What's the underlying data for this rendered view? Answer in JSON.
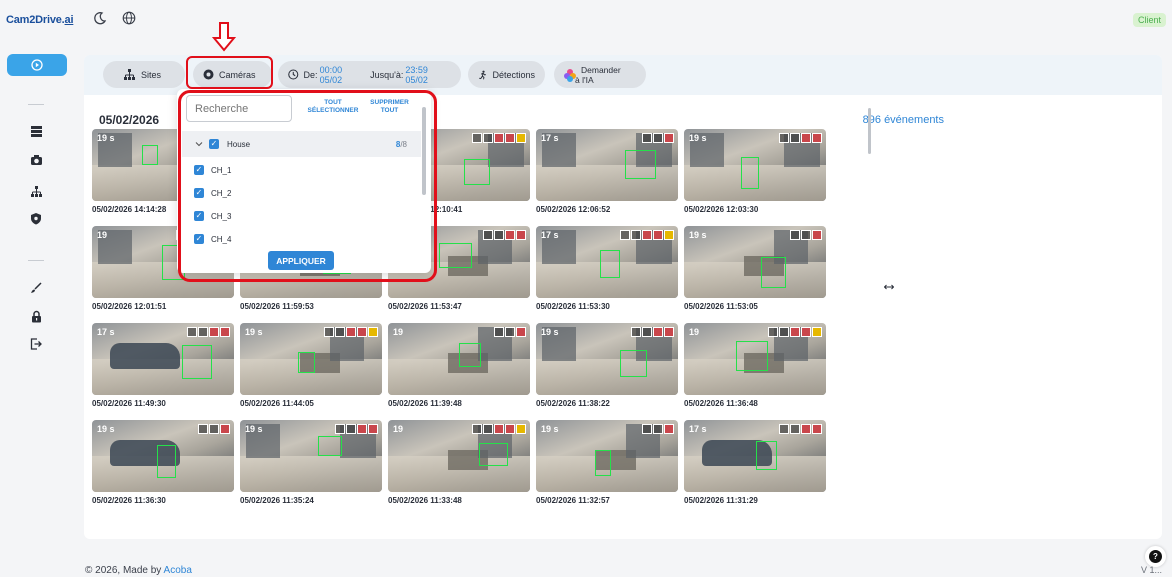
{
  "app": {
    "logo_text": "Cam2Drive.",
    "logo_ai": "ai",
    "client_badge": "Client"
  },
  "sidebar": {
    "items": [
      {
        "name": "events",
        "icon": "play-circle-icon",
        "active": true
      },
      {
        "name": "recorders",
        "icon": "server-icon"
      },
      {
        "name": "cameras",
        "icon": "camera-icon"
      },
      {
        "name": "sites",
        "icon": "sitemap-icon"
      },
      {
        "name": "security",
        "icon": "shield-icon"
      },
      {
        "name": "edit",
        "icon": "brush-icon"
      },
      {
        "name": "lock",
        "icon": "lock-icon"
      },
      {
        "name": "logout",
        "icon": "logout-icon"
      }
    ]
  },
  "filters": {
    "sites_label": "Sites",
    "cameras_label": "Caméras",
    "from_label": "De:",
    "from_value": "00:00 05/02",
    "to_label": "Jusqu'à:",
    "to_value": "23:59 05/02",
    "detections_label": "Détections",
    "ask_ai_line1": "Demander",
    "ask_ai_line2": "à l'IA"
  },
  "dropdown": {
    "search_placeholder": "Recherche",
    "select_all_line1": "TOUT",
    "select_all_line2": "SÉLECTIONNER",
    "remove_all_line1": "SUPPRIMER",
    "remove_all_line2": "TOUT",
    "group_name": "House",
    "group_count": "8",
    "group_total": "/8",
    "channels": [
      "CH_1",
      "CH_2",
      "CH_3",
      "CH_4"
    ],
    "apply_label": "APPLIQUER"
  },
  "events": {
    "date": "05/02/2026",
    "count_label": "896 événements",
    "tiles": [
      {
        "duration": "19 s",
        "timestamp": "05/02/2026 14:14:28",
        "scene": "shop"
      },
      {
        "duration": "",
        "timestamp": "",
        "scene": "shop"
      },
      {
        "duration": "",
        "timestamp": "05/02/2026 12:10:41",
        "scene": "shop"
      },
      {
        "duration": "17 s",
        "timestamp": "05/02/2026 12:06:52",
        "scene": "shop"
      },
      {
        "duration": "19 s",
        "timestamp": "05/02/2026 12:03:30",
        "scene": "shop"
      },
      {
        "duration": "19",
        "timestamp": "05/02/2026 12:01:51",
        "scene": "shop"
      },
      {
        "duration": "",
        "timestamp": "05/02/2026 11:59:53",
        "scene": "office"
      },
      {
        "duration": "19",
        "timestamp": "05/02/2026 11:53:47",
        "scene": "office"
      },
      {
        "duration": "17 s",
        "timestamp": "05/02/2026 11:53:30",
        "scene": "shop"
      },
      {
        "duration": "19 s",
        "timestamp": "05/02/2026 11:53:05",
        "scene": "office"
      },
      {
        "duration": "17 s",
        "timestamp": "05/02/2026 11:49:30",
        "scene": "street"
      },
      {
        "duration": "19 s",
        "timestamp": "05/02/2026 11:44:05",
        "scene": "office"
      },
      {
        "duration": "19",
        "timestamp": "05/02/2026 11:39:48",
        "scene": "office"
      },
      {
        "duration": "19 s",
        "timestamp": "05/02/2026 11:38:22",
        "scene": "shop"
      },
      {
        "duration": "19",
        "timestamp": "05/02/2026 11:36:48",
        "scene": "office"
      },
      {
        "duration": "19 s",
        "timestamp": "05/02/2026 11:36:30",
        "scene": "street"
      },
      {
        "duration": "19 s",
        "timestamp": "05/02/2026 11:35:24",
        "scene": "shop"
      },
      {
        "duration": "19",
        "timestamp": "05/02/2026 11:33:48",
        "scene": "office"
      },
      {
        "duration": "19 s",
        "timestamp": "05/02/2026 11:32:57",
        "scene": "office"
      },
      {
        "duration": "17 s",
        "timestamp": "05/02/2026 11:31:29",
        "scene": "street"
      }
    ]
  },
  "footer": {
    "copyright": "© 2026, Made by",
    "company": "Acoba",
    "version": "V 1..."
  },
  "colors": {
    "accent": "#2f86d6",
    "active_nav": "#3aa4e8",
    "highlight": "#e10f1a",
    "detection_box": "#25e04a"
  }
}
